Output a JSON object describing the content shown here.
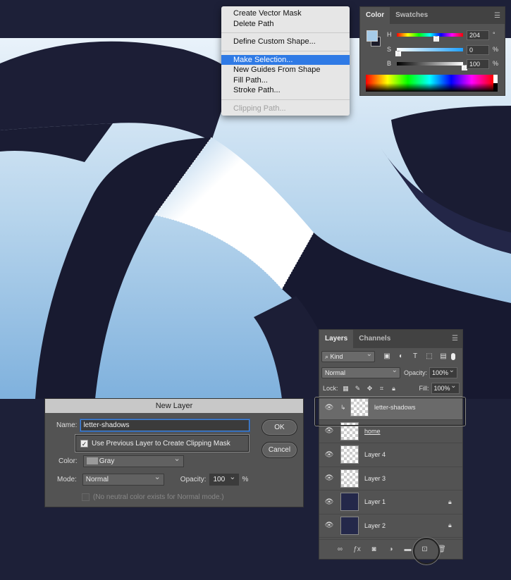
{
  "context_menu": {
    "items": [
      {
        "label": "Create Vector Mask"
      },
      {
        "label": "Delete Path"
      },
      {
        "label": "Define Custom Shape..."
      },
      {
        "label": "Make Selection...",
        "highlighted": true
      },
      {
        "label": "New Guides From Shape"
      },
      {
        "label": "Fill Path..."
      },
      {
        "label": "Stroke Path..."
      },
      {
        "label": "Clipping Path...",
        "disabled": true
      }
    ]
  },
  "color_panel": {
    "tabs": [
      "Color",
      "Swatches"
    ],
    "h": {
      "label": "H",
      "value": "204",
      "unit": "°",
      "level": 0.57
    },
    "s": {
      "label": "S",
      "value": "0",
      "unit": "%",
      "level": 0.0
    },
    "b": {
      "label": "B",
      "value": "100",
      "unit": "%",
      "level": 1.0
    },
    "foreground_color": "#a6cbe8"
  },
  "layers_panel": {
    "tabs": [
      "Layers",
      "Channels"
    ],
    "filter": "Kind",
    "blend_mode": "Normal",
    "opacity_label": "Opacity:",
    "opacity": "100%",
    "lock_label": "Lock:",
    "fill_label": "Fill:",
    "fill": "100%",
    "layers": [
      {
        "name": "letter-shadows",
        "selected": true,
        "clipped": true
      },
      {
        "name": "home",
        "underline": true
      },
      {
        "name": "Layer 4"
      },
      {
        "name": "Layer 3"
      },
      {
        "name": "Layer 1",
        "locked": true
      },
      {
        "name": "Layer 2",
        "locked": true
      }
    ],
    "footer_icons": [
      "link-icon",
      "fx-icon",
      "mask-icon",
      "adjustment-icon",
      "folder-icon",
      "new-layer-icon",
      "trash-icon"
    ]
  },
  "new_layer_dialog": {
    "title": "New Layer",
    "name_label": "Name:",
    "name_value": "letter-shadows",
    "clip_label": "Use Previous Layer to Create Clipping Mask",
    "clip_checked": true,
    "color_label": "Color:",
    "color_value": "Gray",
    "mode_label": "Mode:",
    "mode_value": "Normal",
    "opacity_label": "Opacity:",
    "opacity_value": "100",
    "opacity_unit": "%",
    "neutral_note": "(No neutral color exists for Normal mode.)",
    "ok_label": "OK",
    "cancel_label": "Cancel"
  }
}
